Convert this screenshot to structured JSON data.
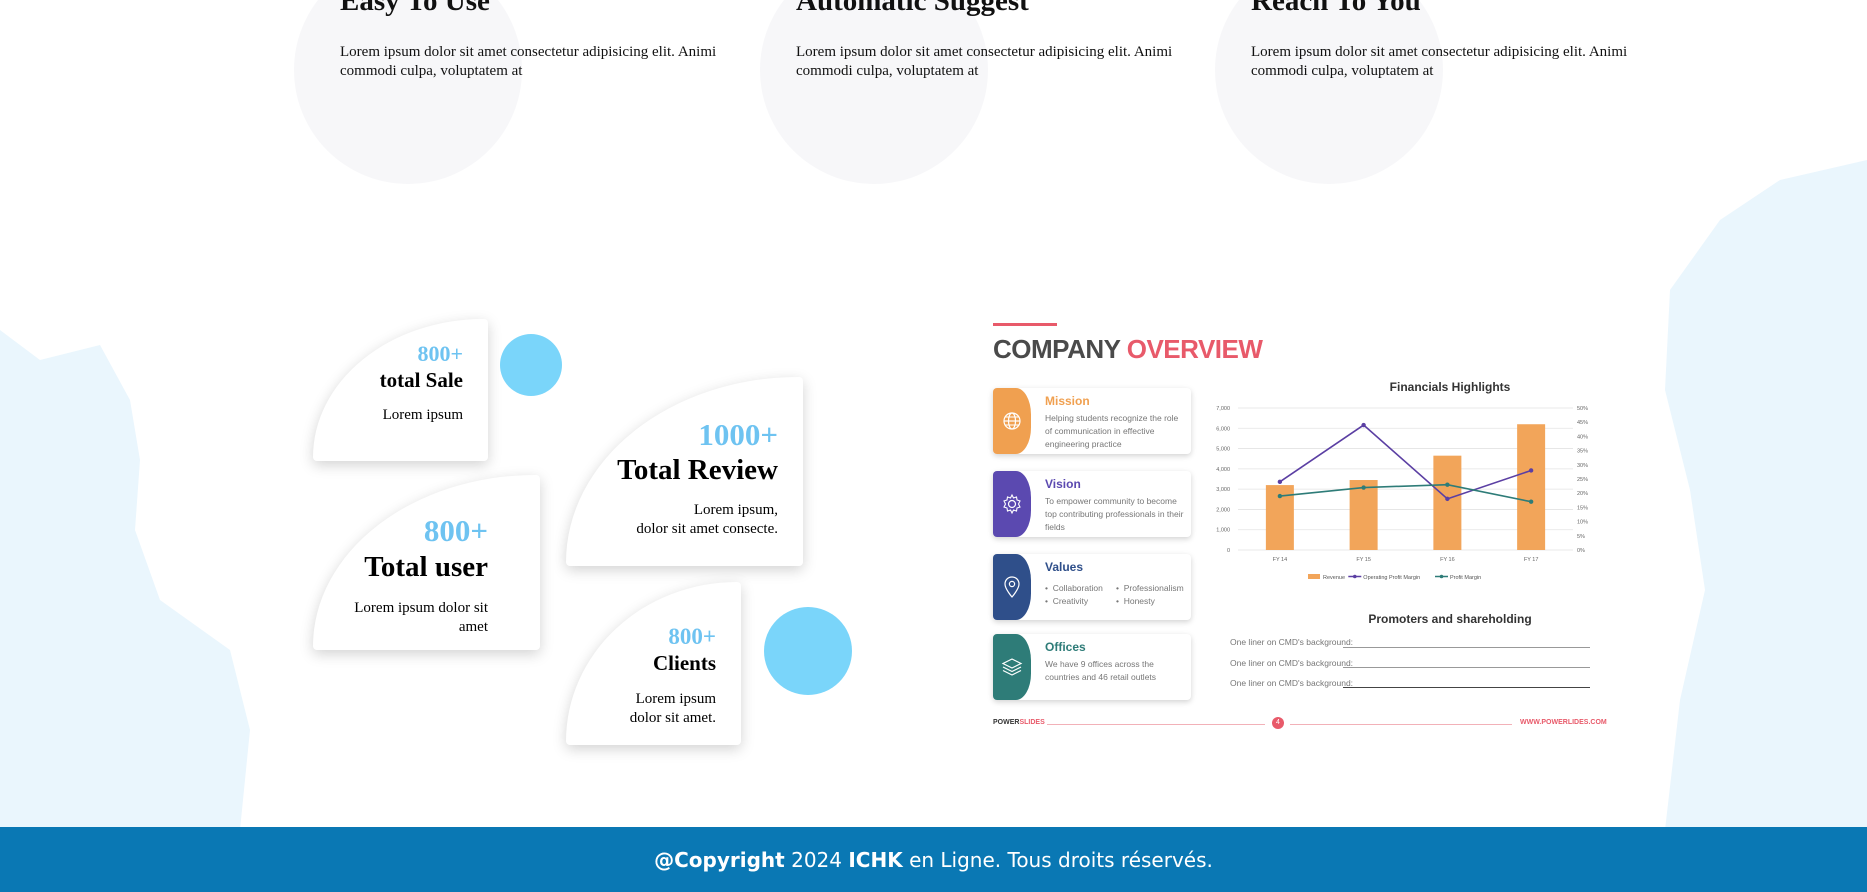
{
  "features": [
    {
      "title": "Easy To Use",
      "text": "Lorem ipsum dolor sit amet consectetur adipisicing elit. Animi commodi culpa, voluptatem at"
    },
    {
      "title": "Automatic Suggest",
      "text": "Lorem ipsum dolor sit amet consectetur adipisicing elit. Animi commodi culpa, voluptatem at"
    },
    {
      "title": "Reach To You",
      "text": "Lorem ipsum dolor sit amet consectetur adipisicing elit. Animi commodi culpa, voluptatem at"
    }
  ],
  "stats": [
    {
      "number": "800+",
      "title": "total Sale",
      "desc": "Lorem ipsum"
    },
    {
      "number": "1000+",
      "title": "Total Review",
      "desc": "Lorem ipsum,\ndolor sit amet consecte."
    },
    {
      "number": "800+",
      "title": "Total user",
      "desc": "Lorem ipsum dolor sit\namet"
    },
    {
      "number": "800+",
      "title": "Clients",
      "desc": "Lorem ipsum\ndolor sit amet."
    }
  ],
  "overview": {
    "title_word1": "COMPANY",
    "title_word2": "OVERVIEW",
    "accent_color": "#e85a6a",
    "cards": [
      {
        "heading": "Mission",
        "text": "Helping students recognize the role of communication in effective engineering practice",
        "color": "#f0a050",
        "icon": "globe-icon"
      },
      {
        "heading": "Vision",
        "text": "To empower community to become top contributing professionals in their fields",
        "color": "#5b49b0",
        "icon": "gear-icon"
      },
      {
        "heading": "Values",
        "bullets": [
          "Collaboration",
          "Professionalism",
          "Creativity",
          "Honesty"
        ],
        "color": "#2f4f8a",
        "icon": "location-pin-icon"
      },
      {
        "heading": "Offices",
        "text": "We have 9 offices across the countries and 46 retail outlets",
        "color": "#2e7c78",
        "icon": "layers-icon"
      }
    ],
    "chart_title": "Financials Highlights",
    "promoters_title": "Promoters and shareholding",
    "liners": [
      "One liner on CMD's background:",
      "One liner on CMD's background:",
      "One liner on CMD's background:"
    ],
    "footer_brand_a": "POWER",
    "footer_brand_b": "SLIDES",
    "footer_page": "4",
    "footer_url": "WWW.POWERLIDES.COM"
  },
  "chart_data": {
    "type": "bar",
    "title": "Financials Highlights",
    "categories": [
      "FY 14",
      "FY 15",
      "FY 16",
      "FY 17"
    ],
    "y_ticks": [
      "0",
      "1,000",
      "2,000",
      "3,000",
      "4,000",
      "5,000",
      "6,000",
      "7,000"
    ],
    "y2_ticks": [
      "0%",
      "5%",
      "10%",
      "15%",
      "20%",
      "25%",
      "30%",
      "35%",
      "40%",
      "45%",
      "50%"
    ],
    "ylim": [
      0,
      7000
    ],
    "y2lim": [
      0,
      50
    ],
    "grid": true,
    "legend_position": "bottom",
    "series": [
      {
        "name": "Revenue",
        "type": "bar",
        "axis": "left",
        "color": "#f2a55a",
        "values": [
          3200,
          3450,
          4650,
          6200
        ]
      },
      {
        "name": "Operating Profit Margin",
        "type": "line",
        "axis": "right",
        "color": "#5b3fa3",
        "values": [
          24,
          44,
          18,
          28
        ]
      },
      {
        "name": "Profit Margin",
        "type": "line",
        "axis": "right",
        "color": "#2e7c78",
        "values": [
          19,
          22,
          23,
          17
        ]
      }
    ]
  },
  "footer": {
    "copyright_bold": "@Copyright",
    "year": "2024",
    "brand": "ICHK",
    "rest": "en Ligne. Tous droits réservés."
  }
}
